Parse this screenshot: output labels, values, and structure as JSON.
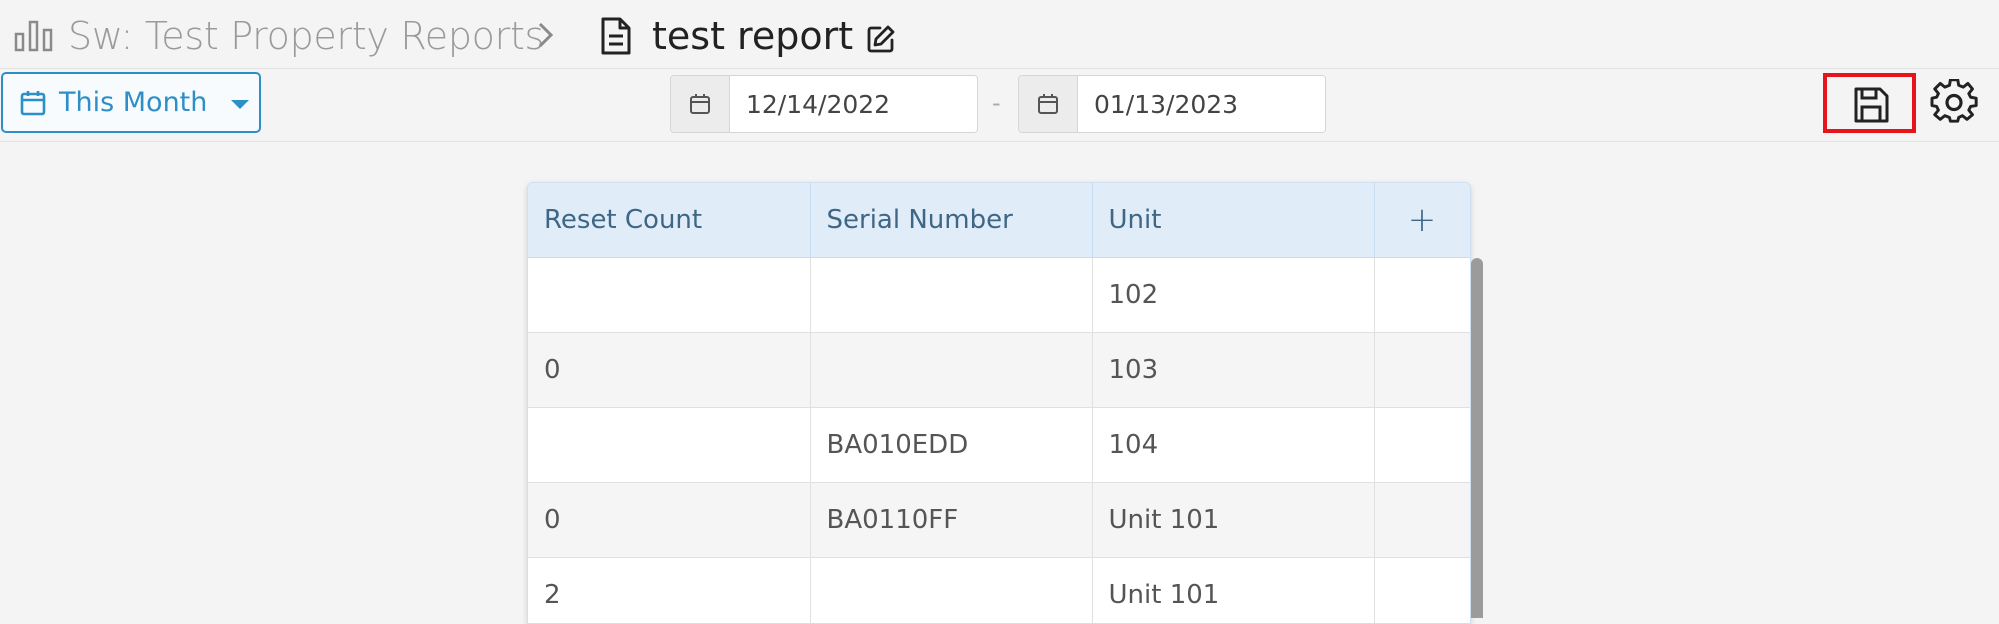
{
  "breadcrumb": {
    "parent": "Sw: Test Property Reports",
    "separator_icon": "chevron-right-icon",
    "current": "test report"
  },
  "toolbar": {
    "range_label": "This Month",
    "start_date": "12/14/2022",
    "date_separator": "-",
    "end_date": "01/13/2023"
  },
  "colors": {
    "accent": "#2d8fc7",
    "highlight_box": "#e8141b",
    "header_bg": "#e0edf8"
  },
  "table": {
    "columns": [
      "Reset Count",
      "Serial Number",
      "Unit"
    ],
    "add_column": "+",
    "rows": [
      [
        "",
        "",
        "102"
      ],
      [
        "0",
        "",
        "103"
      ],
      [
        "",
        "BA010EDD",
        "104"
      ],
      [
        "0",
        "BA0110FF",
        "Unit 101"
      ],
      [
        "2",
        "",
        "Unit 101"
      ]
    ]
  }
}
